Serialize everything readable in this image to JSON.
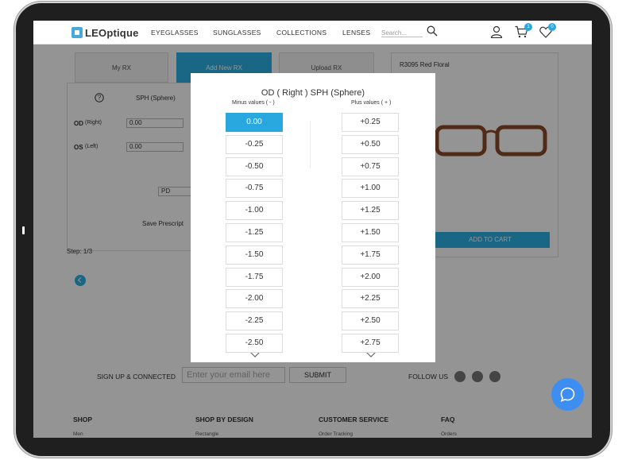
{
  "header": {
    "logo_text": "LEOptique",
    "nav": [
      "EYEGLASSES",
      "SUNGLASSES",
      "COLLECTIONS",
      "LENSES"
    ],
    "search_placeholder": "Search...",
    "cart_count": "1",
    "wishlist_count": "0"
  },
  "rx_tabs": [
    "My RX",
    "Add New RX",
    "Upload RX"
  ],
  "form": {
    "sph_label": "SPH (Sphere)",
    "od_label": "OD",
    "od_sub": "(Right)",
    "os_label": "OS",
    "os_sub": "(Left)",
    "od_value": "0.00",
    "os_value": "0.00",
    "pd_label": "PD",
    "save_label": "Save Prescript"
  },
  "product": {
    "name": "R3095 Red Floral",
    "add_to_cart": "ADD TO CART"
  },
  "step": "Step: 1/3",
  "modal": {
    "title": "OD ( Right ) SPH (Sphere)",
    "minus_header": "Minus values ( - )",
    "plus_header": "Plus values ( + )",
    "minus_values": [
      "0.00",
      "-0.25",
      "-0.50",
      "-0.75",
      "-1.00",
      "-1.25",
      "-1.50",
      "-1.75",
      "-2.00",
      "-2.25",
      "-2.50"
    ],
    "plus_values": [
      "+0.25",
      "+0.50",
      "+0.75",
      "+1.00",
      "+1.25",
      "+1.50",
      "+1.75",
      "+2.00",
      "+2.25",
      "+2.50",
      "+2.75"
    ],
    "selected": "0.00"
  },
  "footer": {
    "signup": "SIGN UP & CONNECTED",
    "email_placeholder": "Enter your email here",
    "submit": "SUBMIT",
    "follow": "FOLLOW US",
    "cols": [
      "SHOP",
      "SHOP BY DESIGN",
      "CUSTOMER SERVICE",
      "FAQ"
    ],
    "subs": [
      "Men",
      "Rectangle",
      "Order Tracking",
      "Orders"
    ]
  },
  "colors": {
    "accent": "#29a8e0",
    "chat": "#3d8ef0"
  }
}
